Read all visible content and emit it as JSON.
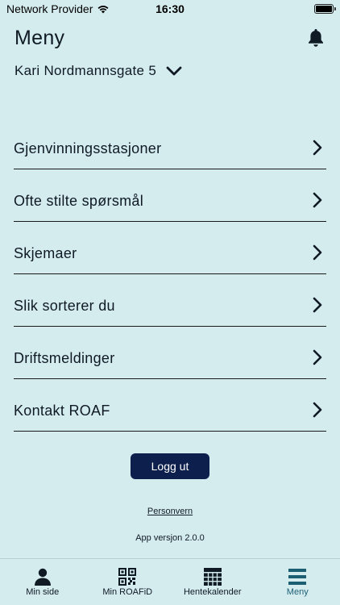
{
  "status_bar": {
    "carrier": "Network Provider",
    "time": "16:30"
  },
  "header": {
    "title": "Meny"
  },
  "address": {
    "label": "Kari Nordmannsgate 5"
  },
  "menu": {
    "items": [
      {
        "label": "Gjenvinningsstasjoner"
      },
      {
        "label": "Ofte stilte spørsmål"
      },
      {
        "label": "Skjemaer"
      },
      {
        "label": "Slik sorterer du"
      },
      {
        "label": "Driftsmeldinger"
      },
      {
        "label": "Kontakt ROAF"
      }
    ]
  },
  "actions": {
    "logout_label": "Logg ut",
    "privacy_label": "Personvern",
    "version_text": "App versjon 2.0.0"
  },
  "tabbar": {
    "tabs": [
      {
        "label": "Min side",
        "icon": "person-icon"
      },
      {
        "label": "Min ROAFiD",
        "icon": "qr-code-icon"
      },
      {
        "label": "Hentekalender",
        "icon": "calendar-grid-icon"
      },
      {
        "label": "Meny",
        "icon": "menu-icon"
      }
    ],
    "active_index": 3
  },
  "colors": {
    "background": "#d5ecef",
    "primary_button": "#0d1f4c",
    "active_tab": "#1c5f73"
  }
}
